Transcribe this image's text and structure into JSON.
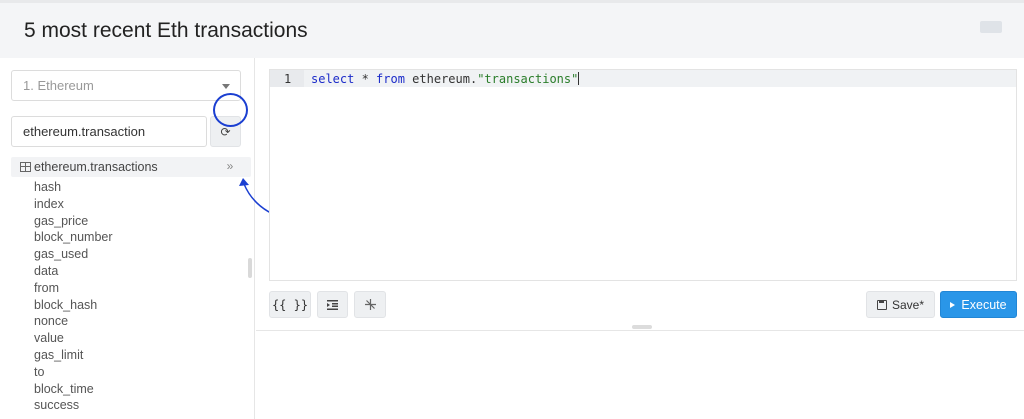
{
  "header": {
    "title": "5 most recent Eth transactions"
  },
  "sidebar": {
    "datasource": "1. Ethereum",
    "schema_filter_value": "ethereum.transaction",
    "table_name": "ethereum.transactions",
    "columns": [
      "hash",
      "index",
      "gas_price",
      "block_number",
      "gas_used",
      "data",
      "from",
      "block_hash",
      "nonce",
      "value",
      "gas_limit",
      "to",
      "block_time",
      "success"
    ]
  },
  "editor": {
    "line_number": "1",
    "code": {
      "kw1": "select",
      "plain1": " * ",
      "kw2": "from",
      "plain2": " ethereum.",
      "str": "\"transactions\""
    }
  },
  "toolbar": {
    "params_label": "{{ }}",
    "save_label": "Save*",
    "execute_label": "Execute"
  },
  "colors": {
    "accent": "#2a96e8",
    "annotation": "#1b3fd1",
    "keyword": "#1b2bc9",
    "string": "#2a7d2a"
  },
  "icons": [
    "caret-down-icon",
    "refresh-icon",
    "table-icon",
    "double-chevron-right-icon",
    "indent-icon",
    "autocomplete-icon",
    "save-icon",
    "play-icon"
  ]
}
